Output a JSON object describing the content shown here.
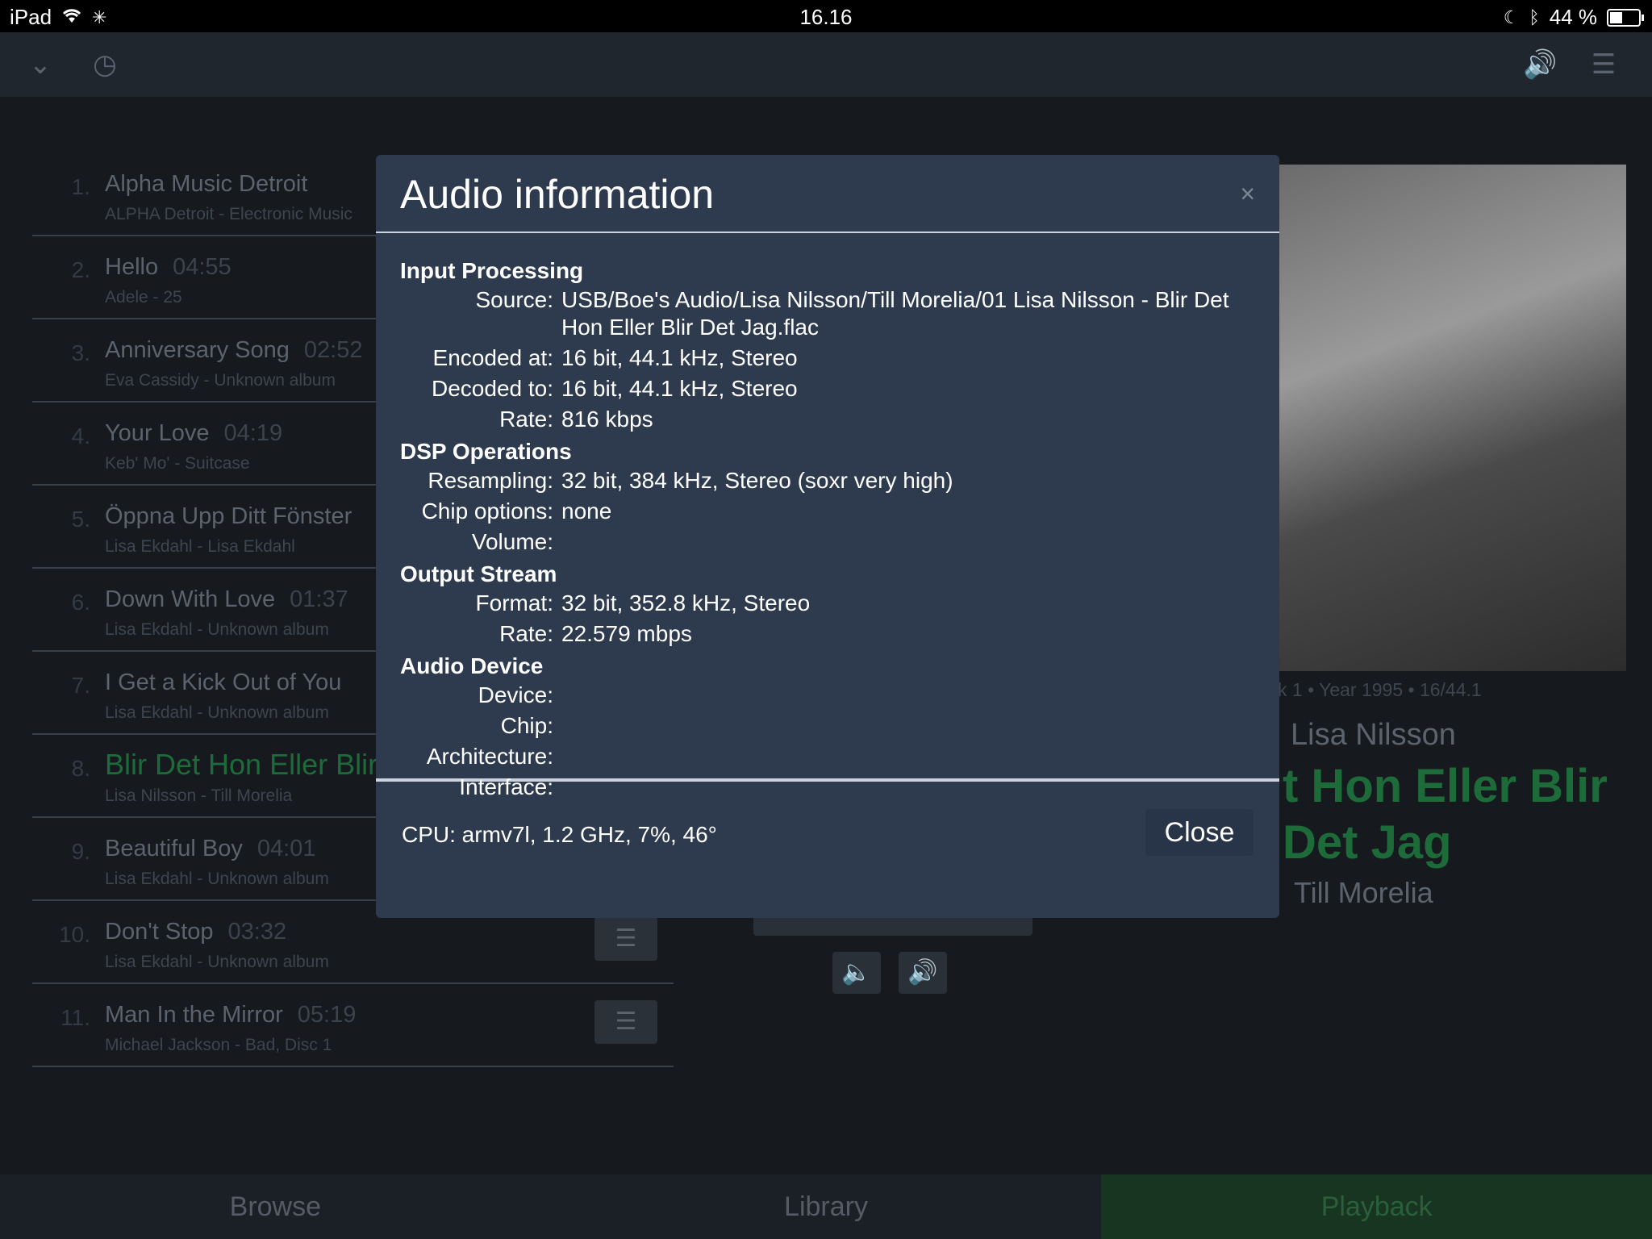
{
  "status_bar": {
    "device": "iPad",
    "time": "16.16",
    "battery_text": "44 %",
    "battery_level": 0.44
  },
  "queue": [
    {
      "num": "1.",
      "title": "Alpha Music Detroit",
      "duration": "",
      "subtitle": "ALPHA Detroit - Electronic Music"
    },
    {
      "num": "2.",
      "title": "Hello",
      "duration": "04:55",
      "subtitle": "Adele - 25"
    },
    {
      "num": "3.",
      "title": "Anniversary Song",
      "duration": "02:52",
      "subtitle": "Eva Cassidy - Unknown album"
    },
    {
      "num": "4.",
      "title": "Your Love",
      "duration": "04:19",
      "subtitle": "Keb' Mo' - Suitcase"
    },
    {
      "num": "5.",
      "title": "Öppna Upp Ditt Fönster",
      "duration": "",
      "subtitle": "Lisa Ekdahl - Lisa Ekdahl"
    },
    {
      "num": "6.",
      "title": "Down With Love",
      "duration": "01:37",
      "subtitle": "Lisa Ekdahl - Unknown album"
    },
    {
      "num": "7.",
      "title": "I Get a Kick Out of You",
      "duration": "",
      "subtitle": "Lisa Ekdahl - Unknown album"
    },
    {
      "num": "8.",
      "title": "Blir Det Hon Eller Blir",
      "duration": "",
      "subtitle": "Lisa Nilsson - Till Morelia"
    },
    {
      "num": "9.",
      "title": "Beautiful Boy",
      "duration": "04:01",
      "subtitle": "Lisa Ekdahl - Unknown album"
    },
    {
      "num": "10.",
      "title": "Don't Stop",
      "duration": "03:32",
      "subtitle": "Lisa Ekdahl - Unknown album"
    },
    {
      "num": "11.",
      "title": "Man In the Mirror",
      "duration": "05:19",
      "subtitle": "Michael Jackson - Bad, Disc 1"
    }
  ],
  "now_playing": {
    "meta": "k 1 • Year 1995 • 16/44.1",
    "artist": "Lisa Nilsson",
    "title_line1": "t Hon Eller Blir",
    "title_line2": "Det Jag",
    "album": "Till Morelia"
  },
  "tabs": [
    "Browse",
    "Library",
    "Playback"
  ],
  "modal": {
    "title": "Audio information",
    "close_x": "×",
    "input_processing": {
      "heading": "Input Processing",
      "source_label": "Source:",
      "source_line1": "USB/Boe's Audio/Lisa Nilsson/Till Morelia/01 Lisa Nilsson - Blir Det",
      "source_line2": "Hon Eller Blir Det Jag.flac",
      "encoded_label": "Encoded at:",
      "encoded": "16 bit, 44.1 kHz, Stereo",
      "decoded_label": "Decoded to:",
      "decoded": "16 bit, 44.1 kHz, Stereo",
      "rate_label": "Rate:",
      "rate": "816 kbps"
    },
    "dsp": {
      "heading": "DSP Operations",
      "resampling_label": "Resampling:",
      "resampling": "32 bit, 384 kHz, Stereo (soxr very high)",
      "chip_label": "Chip options:",
      "chip": "none",
      "volume_label": "Volume:",
      "volume": ""
    },
    "output": {
      "heading": "Output Stream",
      "format_label": "Format:",
      "format": "32 bit, 352.8 kHz, Stereo",
      "rate_label": "Rate:",
      "rate": "22.579 mbps"
    },
    "device": {
      "heading": "Audio Device",
      "device_label": "Device:",
      "chip_label": "Chip:",
      "arch_label": "Architecture:",
      "interface_label": "Interface:"
    },
    "cpu": "CPU: armv7l, 1.2 GHz, 7%, 46°",
    "close_button": "Close"
  }
}
